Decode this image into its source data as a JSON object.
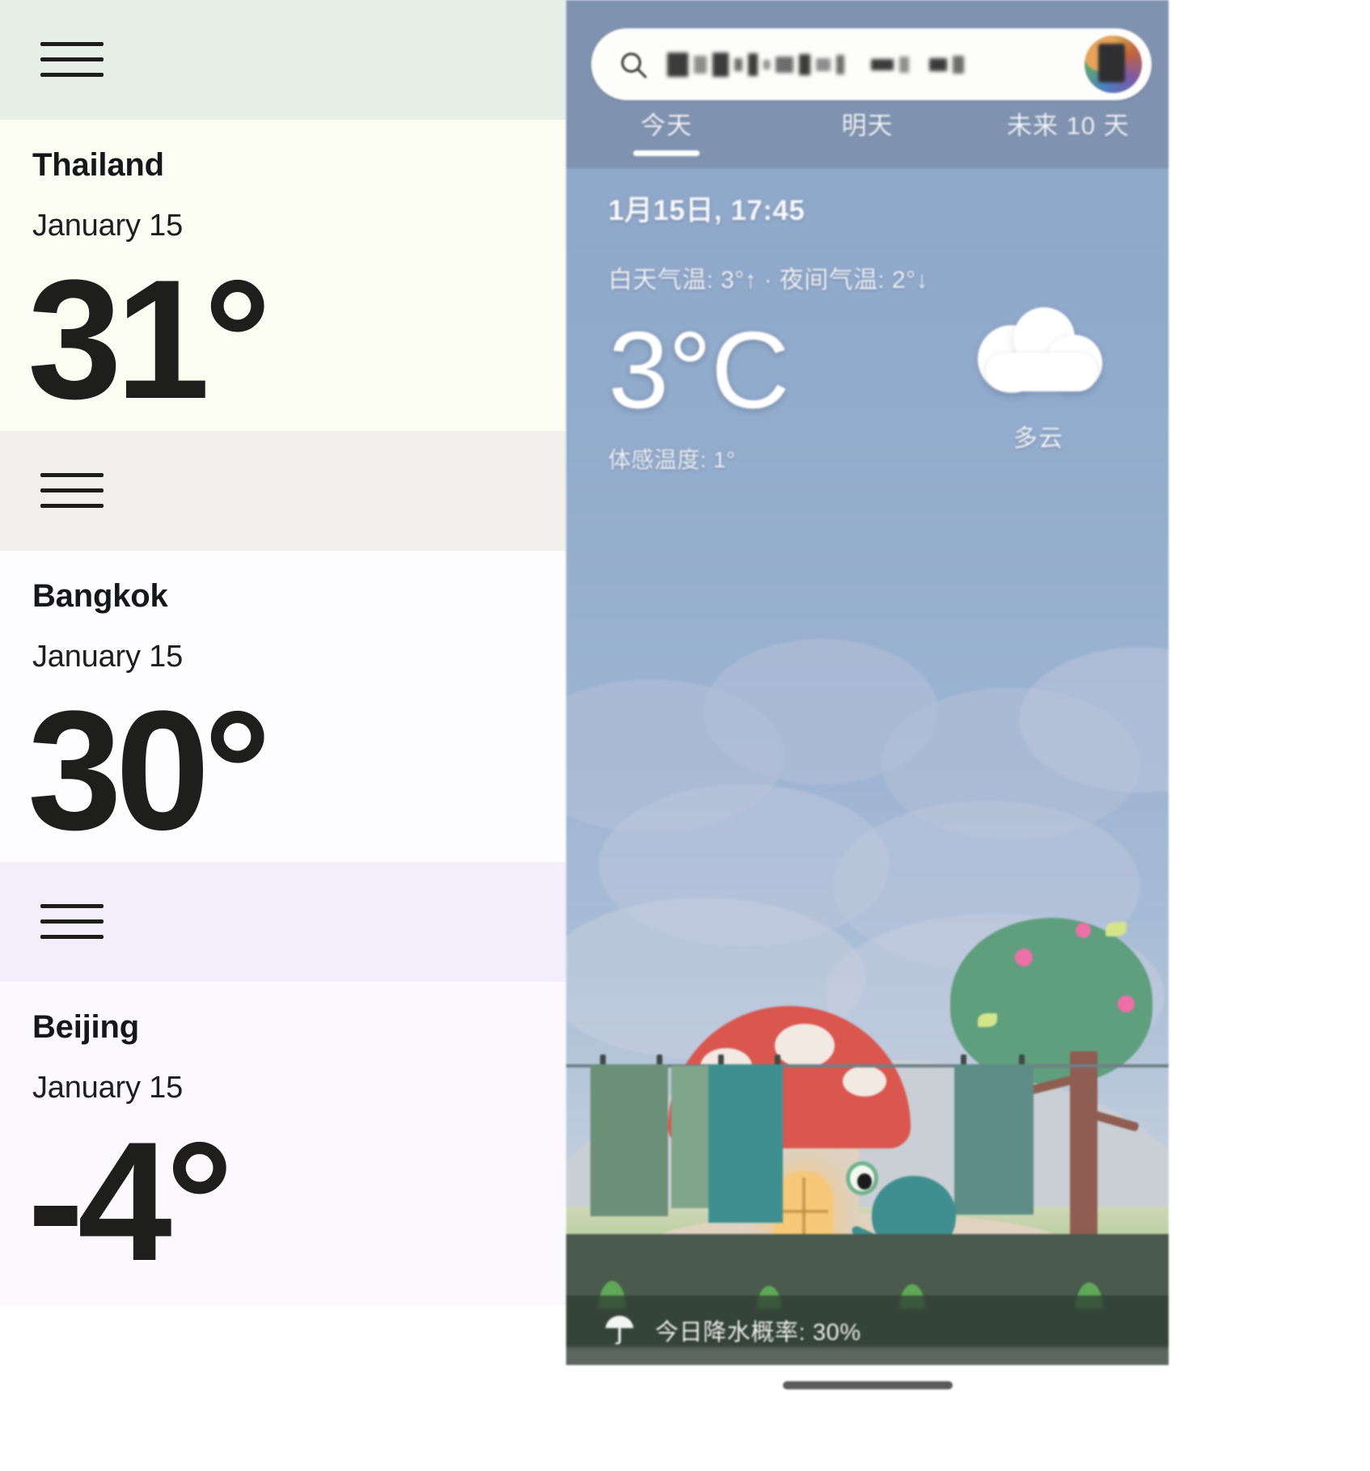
{
  "left_panel": {
    "cards": [
      {
        "handle_icon": "hamburger-icon",
        "city": "Thailand",
        "date": "January 15",
        "temperature": "31°",
        "handle_bg": "#e7f0e6",
        "body_bg": "#fbfcf2"
      },
      {
        "handle_icon": "hamburger-icon",
        "city": "Bangkok",
        "date": "January 15",
        "temperature": "30°",
        "handle_bg": "#f2f0ed",
        "body_bg": "#fdfcfe"
      },
      {
        "handle_icon": "hamburger-icon",
        "city": "Beijing",
        "date": "January 15",
        "temperature": "-4°",
        "handle_bg": "#f2eefa",
        "body_bg": "#fbf9fe"
      }
    ]
  },
  "phone": {
    "search": {
      "icon": "search-icon",
      "query_redacted": "████ ████  ██ ██",
      "avatar": "user-avatar"
    },
    "tabs": [
      {
        "label": "今天",
        "active": true
      },
      {
        "label": "明天",
        "active": false
      },
      {
        "label": "未来 10 天",
        "active": false
      }
    ],
    "detail": {
      "datetime": "1月15日, 17:45",
      "high_low": "白天气温: 3°↑ · 夜间气温: 2°↓",
      "current_temp": "3°C",
      "feels_like": "体感温度: 1°",
      "condition_icon": "cloud-icon",
      "condition_label": "多云"
    },
    "precipitation": {
      "icon": "umbrella-icon",
      "text": "今日降水概率: 30%"
    },
    "home_indicator": "home-indicator"
  },
  "colors": {
    "sky_top": "#7f93b0",
    "sky_mid": "#9cb3d2",
    "mushroom_cap": "#d9574f",
    "frog": "#3f8f90",
    "tree_foliage": "#5f9f7e",
    "precip_bar": "#2c3b32",
    "text_dark": "#16171a"
  }
}
